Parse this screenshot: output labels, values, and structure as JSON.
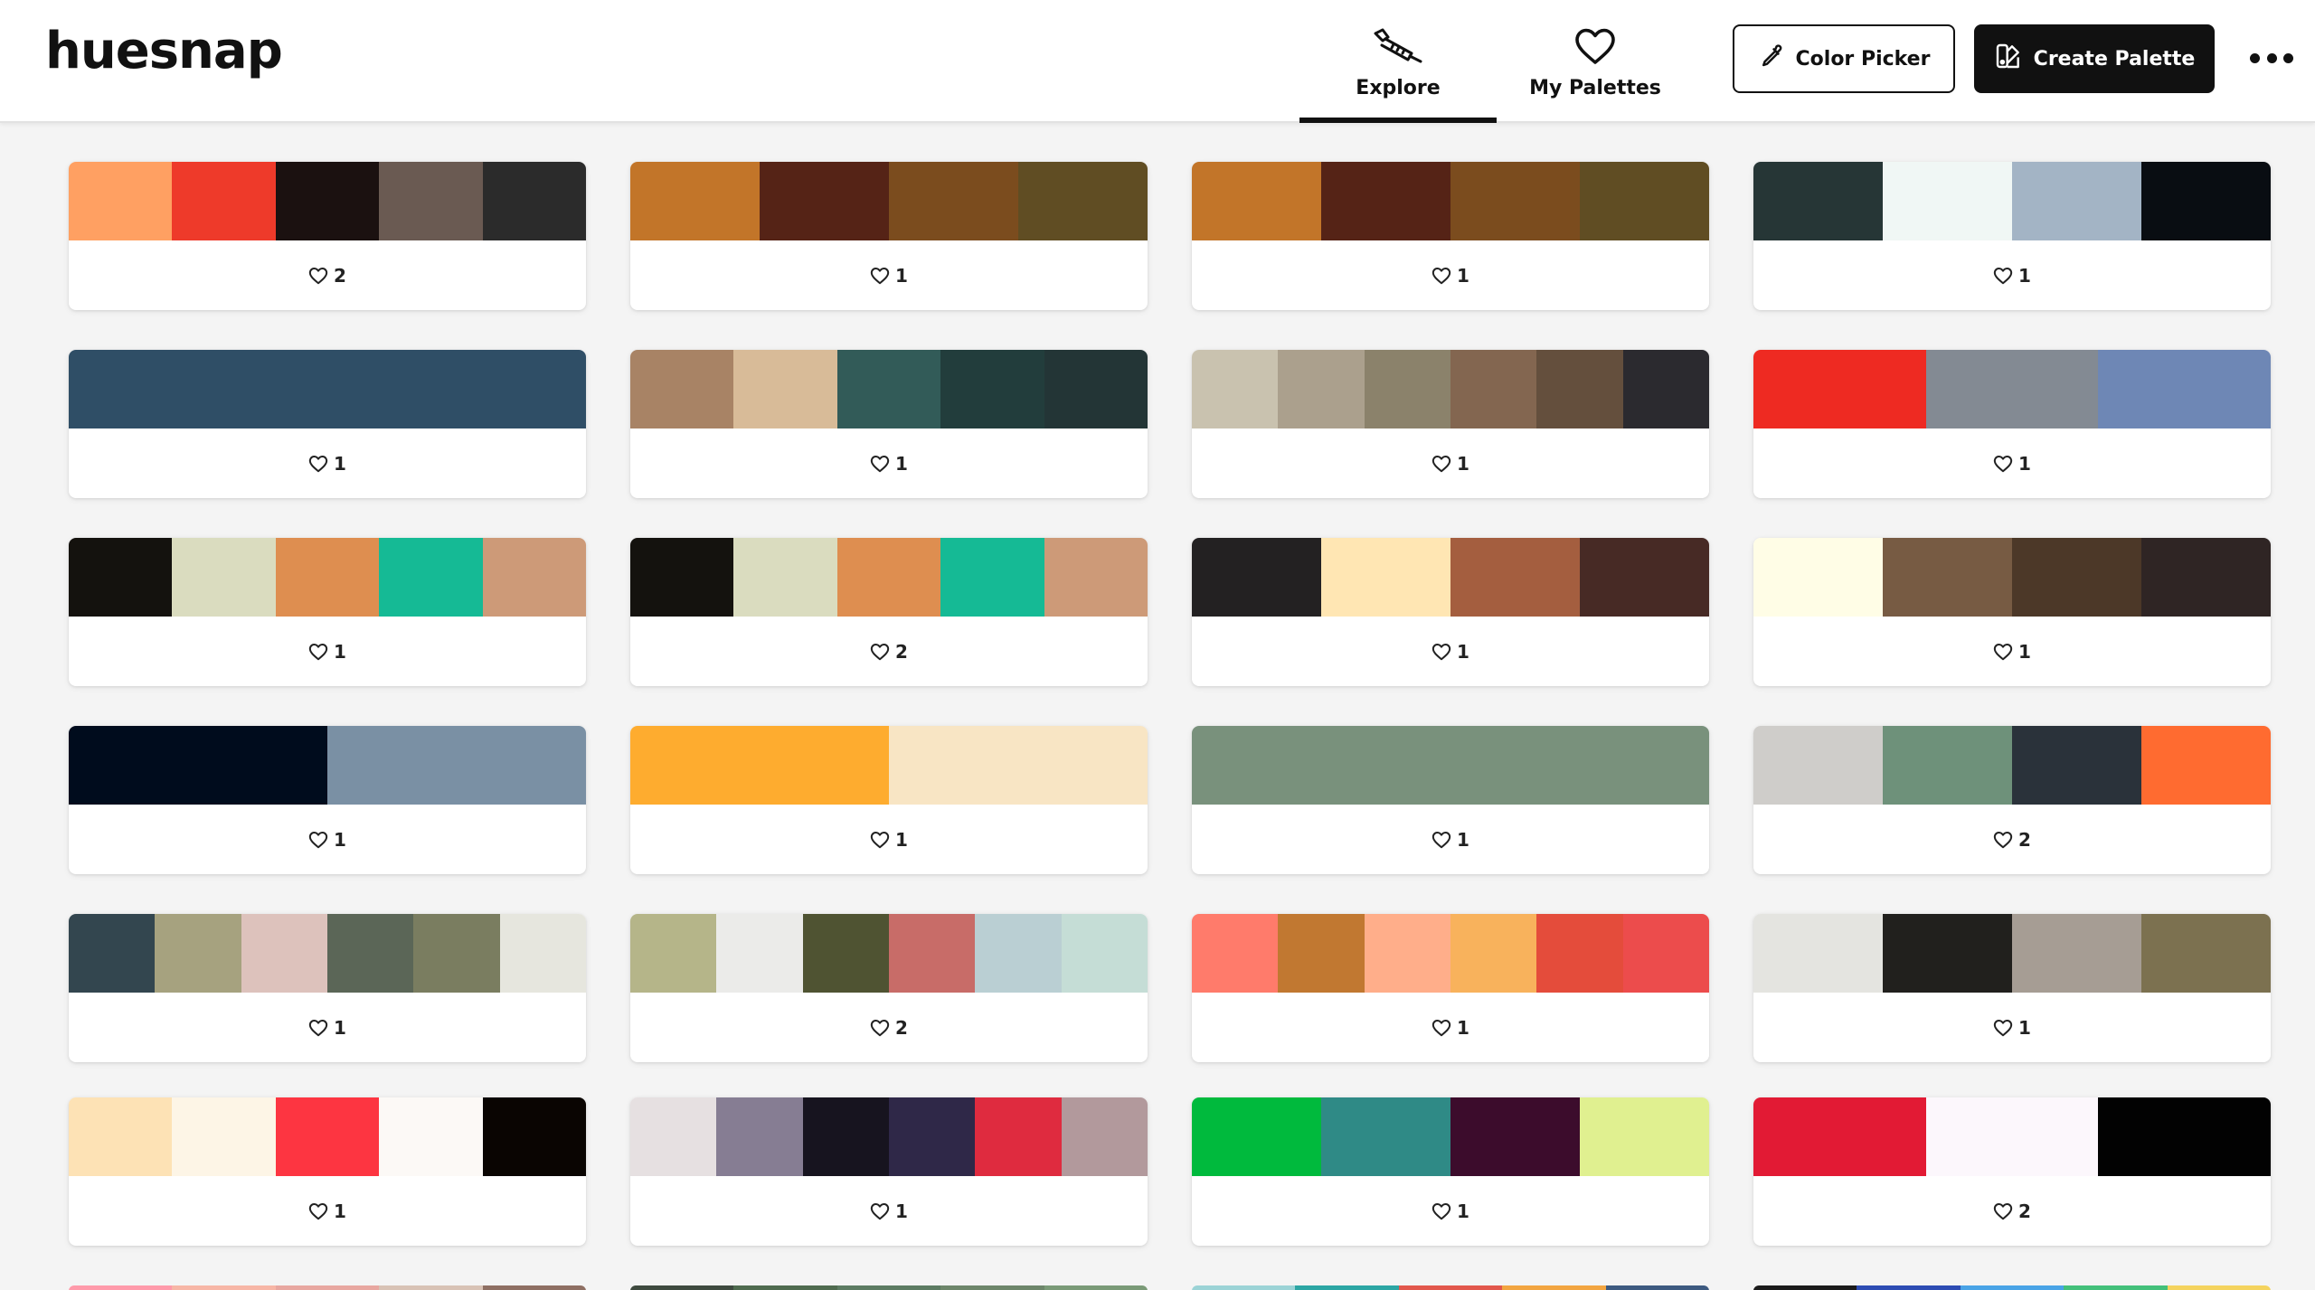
{
  "app": {
    "name": "huesnap"
  },
  "nav": [
    {
      "label": "Explore",
      "icon": "eyedropper-icon",
      "active": true
    },
    {
      "label": "My Palettes",
      "icon": "heart-icon",
      "active": false
    }
  ],
  "actions": {
    "color_picker": {
      "label": "Color Picker",
      "icon": "pipette-icon"
    },
    "create_palette": {
      "label": "Create Palette",
      "icon": "palette-icon"
    },
    "more": {
      "icon": "more-horizontal-icon"
    }
  },
  "palettes": [
    {
      "colors": [
        "#FFA062",
        "#EE3A2A",
        "#1B1110",
        "#6A5A52",
        "#2B2B2B"
      ],
      "likes": "2"
    },
    {
      "colors": [
        "#C27529",
        "#552316",
        "#7B4C1E",
        "#604D23"
      ],
      "likes": "1"
    },
    {
      "colors": [
        "#C27529",
        "#552316",
        "#7B4C1E",
        "#604D23"
      ],
      "likes": "1"
    },
    {
      "colors": [
        "#263636",
        "#F0F7F5",
        "#A3B4C5",
        "#090D12"
      ],
      "likes": "1"
    },
    {
      "colors": [
        "#2F4E66"
      ],
      "likes": "1"
    },
    {
      "colors": [
        "#A88365",
        "#D8BB98",
        "#325B58",
        "#223D3C",
        "#233536"
      ],
      "likes": "1"
    },
    {
      "colors": [
        "#C9C2AF",
        "#ABA08D",
        "#8B826B",
        "#836650",
        "#644F3D",
        "#2B2A2F"
      ],
      "likes": "1"
    },
    {
      "colors": [
        "#EE2A22",
        "#838A93",
        "#6E87B5"
      ],
      "likes": "1"
    },
    {
      "colors": [
        "#14120E",
        "#DADCBF",
        "#DE8E50",
        "#15BA95",
        "#CD9A78"
      ],
      "likes": "1"
    },
    {
      "colors": [
        "#14120E",
        "#DADCBF",
        "#DE8E50",
        "#15BA95",
        "#CD9A78"
      ],
      "likes": "2"
    },
    {
      "colors": [
        "#232122",
        "#FFE6B3",
        "#A45E3F",
        "#472A25"
      ],
      "likes": "1"
    },
    {
      "colors": [
        "#FFFDE6",
        "#775B43",
        "#4C3828",
        "#2F2524"
      ],
      "likes": "1"
    },
    {
      "colors": [
        "#000C1D",
        "#7A90A4"
      ],
      "likes": "1"
    },
    {
      "colors": [
        "#FEAC2F",
        "#F8E5C4"
      ],
      "likes": "1"
    },
    {
      "colors": [
        "#79917C"
      ],
      "likes": "1"
    },
    {
      "colors": [
        "#CFCDCA",
        "#6E917A",
        "#2A323A",
        "#FF6B30"
      ],
      "likes": "2"
    },
    {
      "colors": [
        "#33464F",
        "#A6A27F",
        "#DDC2BC",
        "#5B6657",
        "#7A7D60",
        "#E6E6DE"
      ],
      "likes": "1"
    },
    {
      "colors": [
        "#B5B589",
        "#EBEBE9",
        "#4F5332",
        "#C86C68",
        "#BACFD3",
        "#C5DDD6"
      ],
      "likes": "2"
    },
    {
      "colors": [
        "#FF7B6B",
        "#C17831",
        "#FFAE8A",
        "#F8B25C",
        "#E44C3B",
        "#EC4C4C"
      ],
      "likes": "1"
    },
    {
      "colors": [
        "#E4E4E0",
        "#21201D",
        "#A69D94",
        "#7C7150"
      ],
      "likes": "1"
    },
    {
      "colors": [
        "#FDE2B5",
        "#FDF5E6",
        "#FD3541",
        "#FCF9F6",
        "#0A0502"
      ],
      "likes": "1"
    },
    {
      "colors": [
        "#E6E0E1",
        "#867D93",
        "#17141F",
        "#2F2848",
        "#DF2B3F",
        "#B2999C"
      ],
      "likes": "1"
    },
    {
      "colors": [
        "#00BA3D",
        "#2F8A86",
        "#3C0C2C",
        "#E0F090"
      ],
      "likes": "1"
    },
    {
      "colors": [
        "#E21A34",
        "#FCF7FC",
        "#020202"
      ],
      "likes": "2"
    }
  ],
  "peek_row": [
    {
      "colors": [
        "#FF9AAA",
        "#F7B6A6",
        "#E8A7A0",
        "#D8C2B5",
        "#8E6F63"
      ]
    },
    {
      "colors": [
        "#3E4A3F",
        "#4F6B4F",
        "#5C7B62",
        "#6D866A",
        "#7A9A77"
      ]
    },
    {
      "colors": [
        "#9BD3D6",
        "#2CA6A4",
        "#E2574C",
        "#F2A541",
        "#3D5A80"
      ]
    },
    {
      "colors": [
        "#1B1B1B",
        "#2D4CB3",
        "#49A3E6",
        "#43C07A",
        "#F4D35E"
      ]
    }
  ]
}
